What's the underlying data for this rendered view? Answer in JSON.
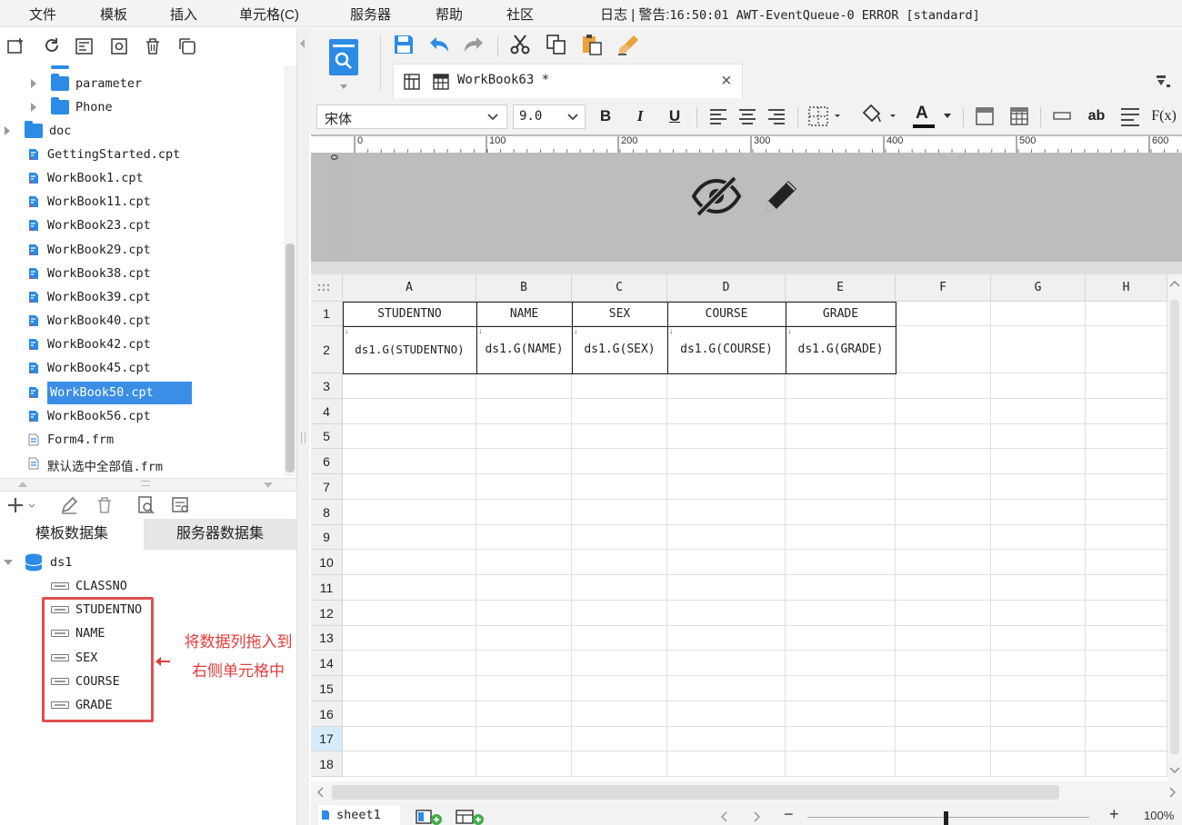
{
  "menu": [
    "文件",
    "模板",
    "插入",
    "单元格(C)",
    "服务器",
    "帮助",
    "社区"
  ],
  "log": {
    "label": "日志",
    "sep": "|",
    "warn_label": "警告:",
    "message": "16:50:01 AWT-EventQueue-0 ERROR [standard]"
  },
  "left_toolbar_icons": [
    "new-folder-icon",
    "refresh-icon",
    "template-icon",
    "settings-icon",
    "delete-icon",
    "copy-icon"
  ],
  "tree": {
    "folders": [
      {
        "label": "parameter",
        "expanded": false
      },
      {
        "label": "Phone",
        "expanded": false
      },
      {
        "label": "doc",
        "expanded": false
      }
    ],
    "files": [
      "GettingStarted.cpt",
      "WorkBook1.cpt",
      "WorkBook11.cpt",
      "WorkBook23.cpt",
      "WorkBook29.cpt",
      "WorkBook38.cpt",
      "WorkBook39.cpt",
      "WorkBook40.cpt",
      "WorkBook42.cpt",
      "WorkBook45.cpt",
      "WorkBook50.cpt",
      "WorkBook56.cpt",
      "Form4.frm",
      "默认选中全部值.frm"
    ],
    "selected": "WorkBook50.cpt"
  },
  "dataset_tabs": [
    "模板数据集",
    "服务器数据集"
  ],
  "dataset": {
    "name": "ds1",
    "columns": [
      "CLASSNO",
      "STUDENTNO",
      "NAME",
      "SEX",
      "COURSE",
      "GRADE"
    ]
  },
  "annotation": {
    "line1": "将数据列拖入到",
    "line2": "右侧单元格中",
    "color": "#e03c3c"
  },
  "editor_tab": {
    "title": "WorkBook63 *",
    "close": "×"
  },
  "font": {
    "family": "宋体",
    "size": "9.0"
  },
  "format_buttons": {
    "bold": "B",
    "italic": "I",
    "underline": "U",
    "text_color": "A",
    "ab": "ab",
    "fx": "F(x)"
  },
  "ruler": [
    "0",
    "100",
    "200",
    "300",
    "400",
    "500",
    "600"
  ],
  "ruler_v": "0",
  "grid": {
    "columns": [
      "A",
      "B",
      "C",
      "D",
      "E",
      "F",
      "G",
      "H"
    ],
    "rows": [
      "1",
      "2",
      "3",
      "4",
      "5",
      "6",
      "7",
      "8",
      "9",
      "10",
      "11",
      "12",
      "13",
      "14",
      "15",
      "16",
      "17",
      "18"
    ],
    "active_row": "17",
    "header_row": [
      "STUDENTNO",
      "NAME",
      "SEX",
      "COURSE",
      "GRADE"
    ],
    "data_row": [
      "ds1.G(STUDENTNO)",
      "ds1.G(NAME)",
      "ds1.G(SEX)",
      "ds1.G(COURSE)",
      "ds1.G(GRADE)"
    ]
  },
  "status": {
    "sheet": "sheet1",
    "zoom_minus": "−",
    "zoom_plus": "+",
    "zoom": "100%"
  },
  "colors": {
    "accent": "#3a8ee6",
    "folder": "#2b8be6",
    "highlight": "#e05050"
  }
}
